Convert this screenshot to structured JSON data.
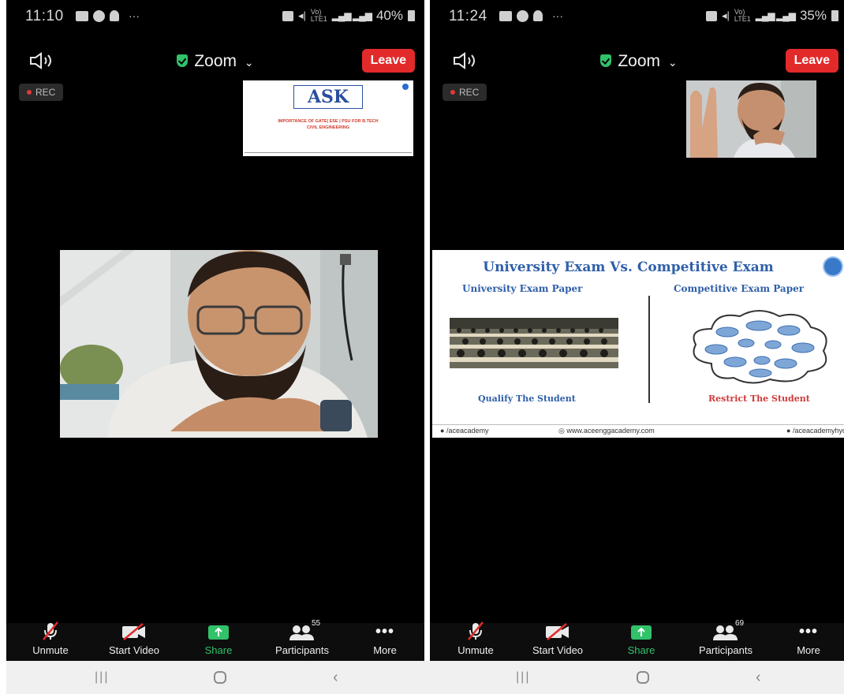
{
  "left": {
    "status": {
      "time": "11:10",
      "battery": "40%",
      "more": "···"
    },
    "app_title": "Zoom",
    "leave_label": "Leave",
    "rec_label": "REC",
    "thumb_slide": {
      "logo": "ASK",
      "line1": "IMPORTANCE OF GATE| ESE | PSU FOR B.TECH",
      "line2": "CIVIL ENGINEERING"
    },
    "toolbar": {
      "unmute": "Unmute",
      "start_video": "Start Video",
      "share": "Share",
      "participants": "Participants",
      "participants_count": "55",
      "more": "More"
    }
  },
  "right": {
    "status": {
      "time": "11:24",
      "battery": "35%",
      "more": "···"
    },
    "app_title": "Zoom",
    "leave_label": "Leave",
    "rec_label": "REC",
    "slide": {
      "title": "University Exam Vs. Competitive Exam",
      "left_heading": "University Exam Paper",
      "right_heading": "Competitive Exam Paper",
      "left_caption": "Qualify The Student",
      "right_caption": "Restrict The Student",
      "footer_left": "/aceacademy",
      "footer_center": "www.aceenggacademy.com",
      "footer_right": "/aceacademyhyd"
    },
    "toolbar": {
      "unmute": "Unmute",
      "start_video": "Start Video",
      "share": "Share",
      "participants": "Participants",
      "participants_count": "69",
      "more": "More"
    }
  },
  "colors": {
    "leave": "#e32a2a",
    "share_green": "#31c26a",
    "slide_blue": "#2f5fa9",
    "slide_red": "#d03a3a"
  },
  "icons": [
    "speaker-icon",
    "shield-icon",
    "chevron-down-icon",
    "mic-muted-icon",
    "video-off-icon",
    "share-icon",
    "participants-icon",
    "more-icon",
    "recents-icon",
    "home-icon",
    "back-icon"
  ]
}
